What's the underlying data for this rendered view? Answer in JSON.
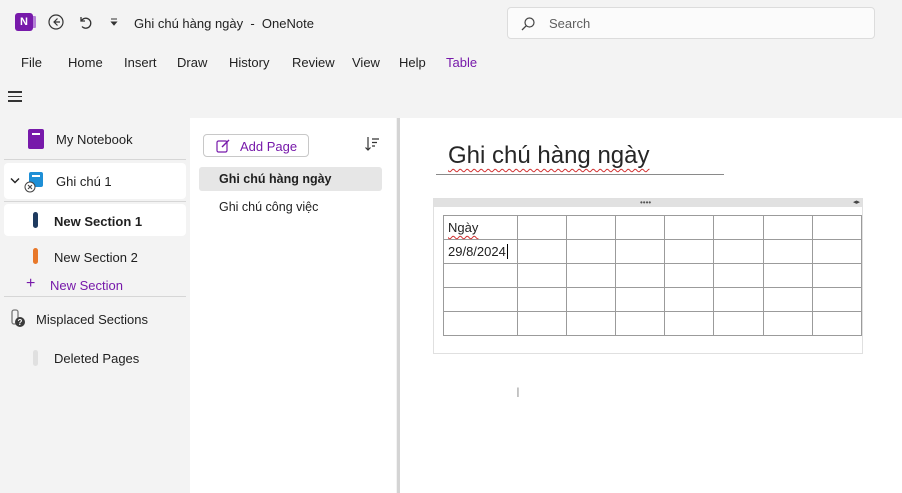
{
  "window": {
    "title": "Ghi chú hàng ngày  -  OneNote",
    "app_icon_letter": "N",
    "search_placeholder": "Search"
  },
  "menu": [
    "File",
    "Home",
    "Insert",
    "Draw",
    "History",
    "Review",
    "View",
    "Help",
    "Table"
  ],
  "accent_color": "#7719aa",
  "notebook_pane": {
    "notebook": "My Notebook",
    "section_group": "Ghi chú 1",
    "sections": [
      {
        "label": "New Section 1",
        "color": "#1e3a5f",
        "active": true
      },
      {
        "label": "New Section 2",
        "color": "#e8782a",
        "active": false
      }
    ],
    "new_section": "New Section",
    "misplaced": "Misplaced Sections",
    "deleted": "Deleted Pages"
  },
  "pages_pane": {
    "add_page": "Add Page",
    "pages": [
      {
        "label": "Ghi chú hàng ngày",
        "selected": true
      },
      {
        "label": "Ghi chú công việc",
        "selected": false
      }
    ]
  },
  "page": {
    "title": "Ghi chú hàng ngày",
    "table": [
      [
        "Ngày",
        "",
        "",
        "",
        "",
        "",
        "",
        ""
      ],
      [
        "29/8/2024",
        "",
        "",
        "",
        "",
        "",
        "",
        ""
      ],
      [
        "",
        "",
        "",
        "",
        "",
        "",
        "",
        ""
      ],
      [
        "",
        "",
        "",
        "",
        "",
        "",
        "",
        ""
      ],
      [
        "",
        "",
        "",
        "",
        "",
        "",
        "",
        ""
      ]
    ]
  }
}
